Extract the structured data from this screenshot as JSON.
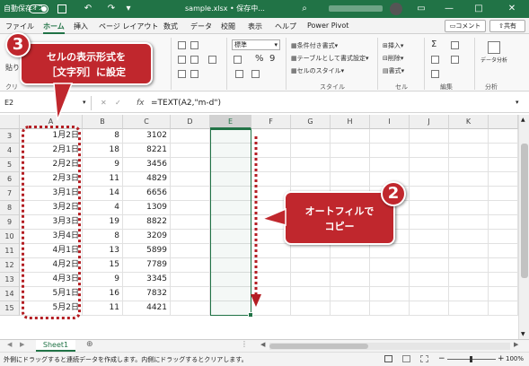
{
  "titlebar": {
    "autosave_label": "自動保存",
    "autosave_state": "オフ",
    "title": "sample.xlsx • 保存中...",
    "search_icon": "search-icon"
  },
  "tabs": [
    "ファイル",
    "ホーム",
    "挿入",
    "ページ レイアウト",
    "数式",
    "データ",
    "校閲",
    "表示",
    "ヘルプ",
    "Power Pivot"
  ],
  "active_tab": "ホーム",
  "share": {
    "comment_label": "コメント",
    "share_label": "共有"
  },
  "ribbon": {
    "paste_label": "貼り",
    "number_format": "標準",
    "percent": "%",
    "comma": "9",
    "styles": [
      "条件付き書式",
      "テーブルとして書式設定",
      "セルのスタイル"
    ],
    "styles_group": "スタイル",
    "cells": [
      "挿入",
      "削除",
      "書式"
    ],
    "cells_group": "セル",
    "sum": "Σ",
    "edit_group": "編集",
    "analysis_label": "データ分析",
    "analysis_group": "分析",
    "clip_group_partial": "クリ"
  },
  "formula_bar": {
    "name_box": "E2",
    "fx": "fx",
    "formula": "=TEXT(A2,\"m-d\")"
  },
  "columns": [
    "A",
    "B",
    "C",
    "D",
    "E",
    "F",
    "G",
    "H",
    "I",
    "J",
    "K"
  ],
  "rows": [
    {
      "num": "3",
      "a": "1月2日",
      "b": "8",
      "c": "3102"
    },
    {
      "num": "4",
      "a": "2月1日",
      "b": "18",
      "c": "8221"
    },
    {
      "num": "5",
      "a": "2月2日",
      "b": "9",
      "c": "3456"
    },
    {
      "num": "6",
      "a": "2月3日",
      "b": "11",
      "c": "4829"
    },
    {
      "num": "7",
      "a": "3月1日",
      "b": "14",
      "c": "6656"
    },
    {
      "num": "8",
      "a": "3月2日",
      "b": "4",
      "c": "1309"
    },
    {
      "num": "9",
      "a": "3月3日",
      "b": "19",
      "c": "8822"
    },
    {
      "num": "10",
      "a": "3月4日",
      "b": "8",
      "c": "3209"
    },
    {
      "num": "11",
      "a": "4月1日",
      "b": "13",
      "c": "5899"
    },
    {
      "num": "12",
      "a": "4月2日",
      "b": "15",
      "c": "7789"
    },
    {
      "num": "13",
      "a": "4月3日",
      "b": "9",
      "c": "3345"
    },
    {
      "num": "14",
      "a": "5月1日",
      "b": "16",
      "c": "7832"
    },
    {
      "num": "15",
      "a": "5月2日",
      "b": "11",
      "c": "4421"
    }
  ],
  "sheet_tab": "Sheet1",
  "status": {
    "message": "外側にドラッグすると連続データを作成します。内側にドラッグするとクリアします。",
    "zoom": "100%"
  },
  "callouts": {
    "badge3": "3",
    "text3_line1": "セルの表示形式を",
    "text3_line2": "［文字列］に設定",
    "badge2": "2",
    "text2_line1": "オートフィルで",
    "text2_line2": "コピー"
  },
  "colors": {
    "excel_green": "#217346",
    "callout_red": "#c0272d",
    "dotted_red": "#b41e23"
  }
}
